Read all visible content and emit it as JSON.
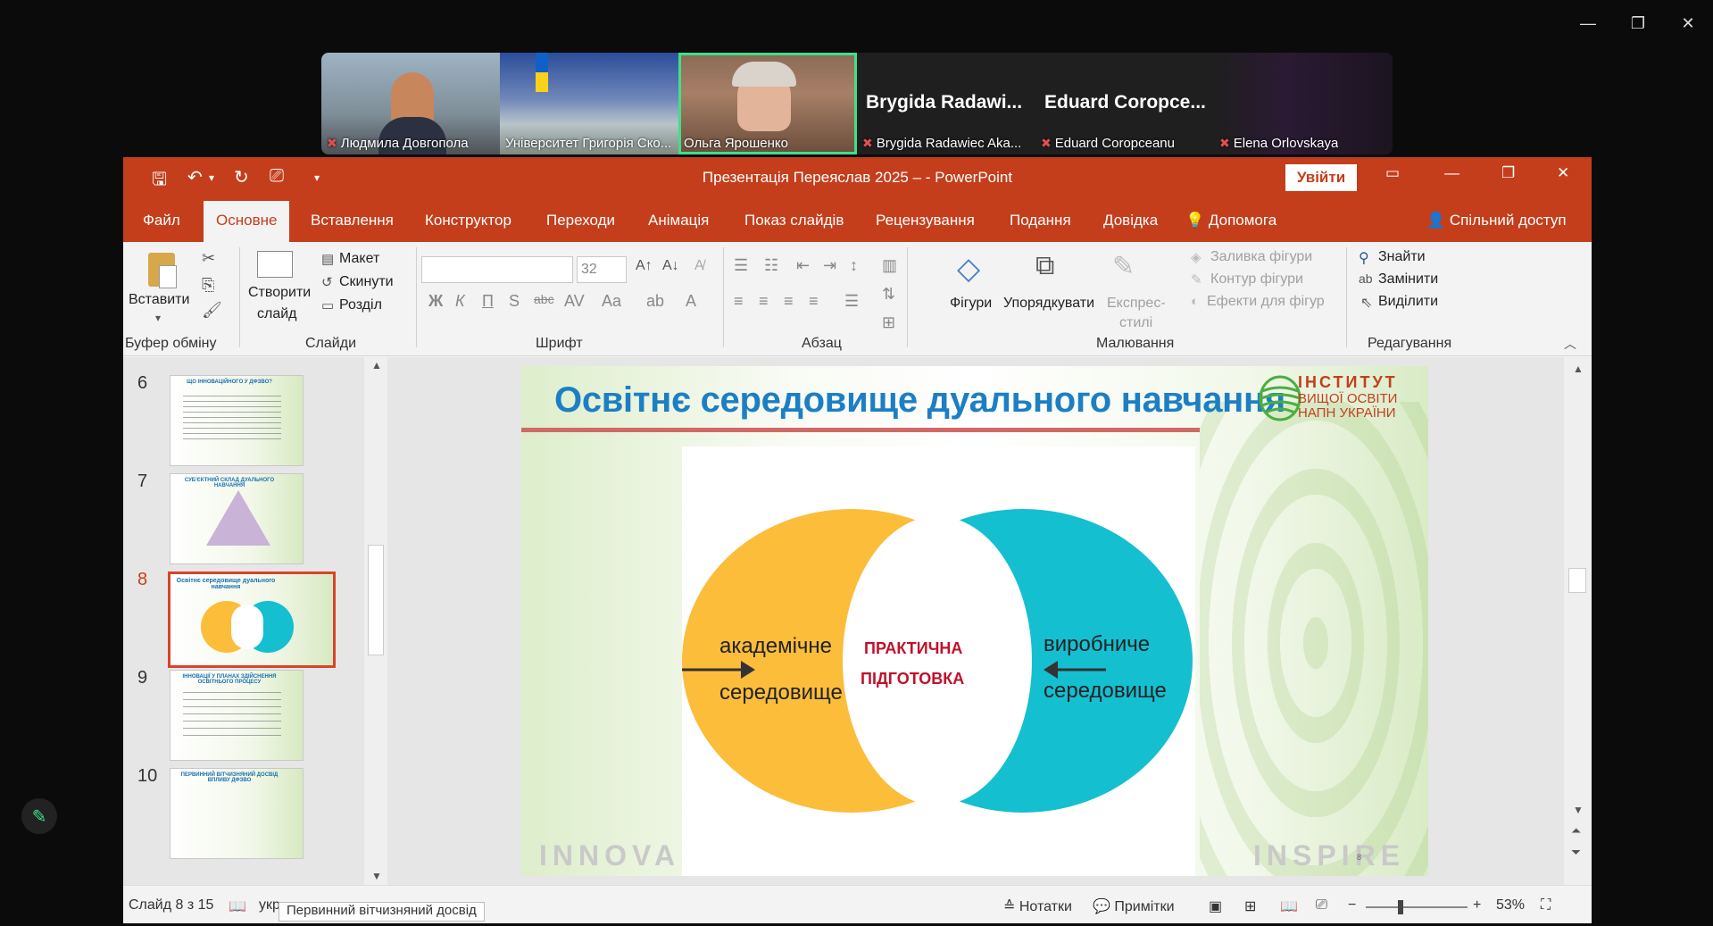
{
  "meeting": {
    "window_controls": [
      "—",
      "❐",
      "✕"
    ],
    "participants": [
      {
        "name": "Людмила Довгопола",
        "muted": true
      },
      {
        "name": "Університет Григорія Ско...",
        "muted": false
      },
      {
        "name": "Ольга Ярошенко",
        "muted": false,
        "active": true
      },
      {
        "name": "Brygida Radawiec Aka...",
        "big": "Brygida  Radawi...",
        "muted": true
      },
      {
        "name": "Eduard Coropceanu",
        "big": "Eduard  Coropce...",
        "muted": true
      },
      {
        "name": "Elena Orlovskaya",
        "muted": true
      }
    ]
  },
  "ppt": {
    "title": "Презентація Переяслав 2025 –  -  PowerPoint",
    "signin": "Увійти",
    "tabs": [
      "Файл",
      "Основне",
      "Вставлення",
      "Конструктор",
      "Переходи",
      "Анімація",
      "Показ слайдів",
      "Рецензування",
      "Подання",
      "Довідка",
      "Допомога"
    ],
    "share": "Спільний доступ",
    "ribbon": {
      "paste": "Вставити",
      "clipboard": "Буфер обміну",
      "new_slide_1": "Створити",
      "new_slide_2": "слайд",
      "layout": "Макет",
      "reset": "Скинути",
      "section": "Розділ",
      "slides": "Слайди",
      "font_size": "32",
      "font_group": "Шрифт",
      "paragraph": "Абзац",
      "shapes": "Фігури",
      "arrange": "Упорядкувати",
      "quick_styles_1": "Експрес-",
      "quick_styles_2": "стилі",
      "shape_fill": "Заливка фігури",
      "shape_outline": "Контур фігури",
      "shape_effects": "Ефекти для фігур",
      "drawing": "Малювання",
      "find": "Знайти",
      "replace": "Замінити",
      "select": "Виділити",
      "editing": "Редагування"
    },
    "thumbnails": [
      {
        "num": "6",
        "title": "ЩО ІННОВАЦІЙНОГО У ДФЗВО?"
      },
      {
        "num": "7",
        "title": "СУБ'ЄКТНИЙ СКЛАД ДУАЛЬНОГО НАВЧАННЯ"
      },
      {
        "num": "8",
        "title": "Освітнє середовище дуального навчання",
        "current": true
      },
      {
        "num": "9",
        "title": "ІННОВАЦІЇ У ПЛАНАХ ЗДІЙСНЕННЯ ОСВІТНЬОГО ПРОЦЕСУ"
      },
      {
        "num": "10",
        "title": "ПЕРВИННИЙ ВІТЧИЗНЯНИЙ ДОСВІД ВПЛИВУ ДФЗВО"
      }
    ],
    "slide": {
      "title": "Освітнє середовище дуального навчання",
      "logo_line1": "ІНСТИТУТ",
      "logo_line2": "ВИЩОЇ ОСВІТИ",
      "logo_line3": "НАПН УКРАЇНИ",
      "left_1": "академічне",
      "left_2": "середовище",
      "center_1": "ПРАКТИЧНА",
      "center_2": "ПІДГОТОВКА",
      "right_1": "виробниче",
      "right_2": "середовище",
      "wm_left": "INNOVA",
      "wm_right": "INSPIRE",
      "page": "8",
      "colors": {
        "left": "#fbbd3a",
        "right": "#14bfd0",
        "title": "#1c7fc4",
        "center": "#c0112a"
      }
    },
    "status": {
      "slide_info": "Слайд 8 з 15",
      "lang": "укр",
      "notes": "Нотатки",
      "comments": "Примітки",
      "zoom": "53%",
      "tooltip": "Первинний вітчизняний досвід"
    }
  }
}
